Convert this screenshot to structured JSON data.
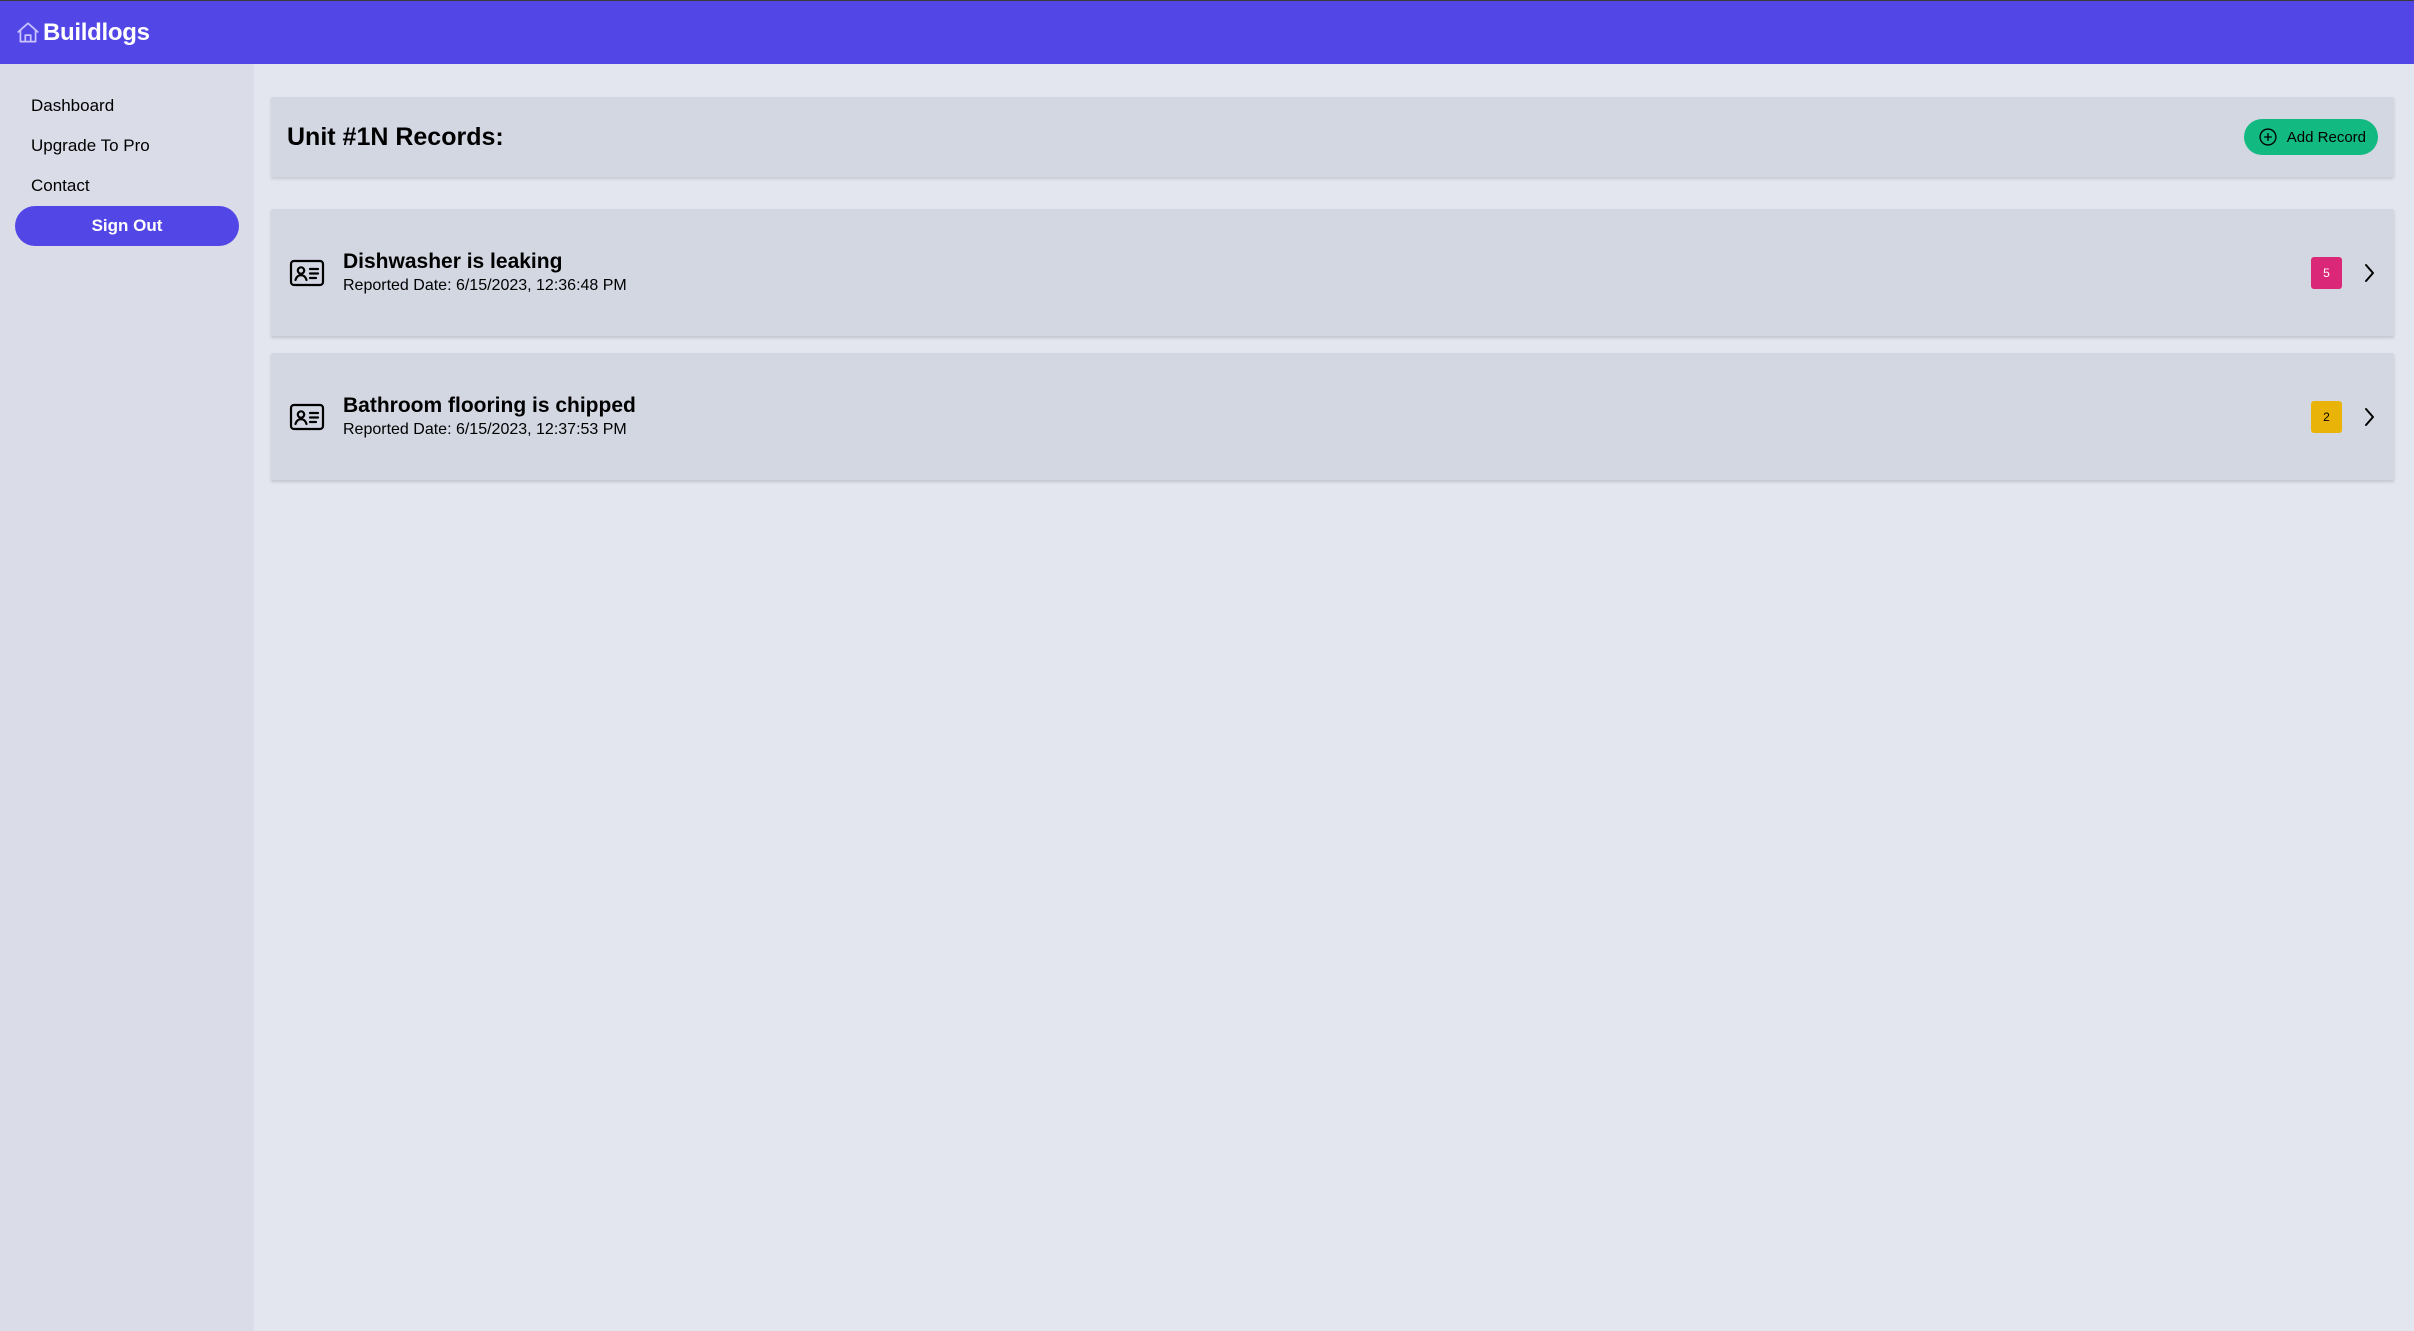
{
  "app": {
    "name": "Buildlogs",
    "icon": "house-icon"
  },
  "sidebar": {
    "items": [
      {
        "label": "Dashboard"
      },
      {
        "label": "Upgrade To Pro"
      },
      {
        "label": "Contact"
      }
    ],
    "signout_label": "Sign Out"
  },
  "main": {
    "title": "Unit #1N Records:",
    "add_record_label": "Add Record",
    "records": [
      {
        "title": "Dishwasher is leaking",
        "date": "Reported Date: 6/15/2023, 12:36:48 PM",
        "badge": "5",
        "badge_color": "#db2777",
        "icon": "id-card-icon"
      },
      {
        "title": "Bathroom flooring is chipped",
        "date": "Reported Date: 6/15/2023, 12:37:53 PM",
        "badge": "2",
        "badge_color": "#eab308",
        "icon": "id-card-icon"
      }
    ]
  },
  "colors": {
    "brand": "#5246e6",
    "accent_green": "#12b981"
  }
}
